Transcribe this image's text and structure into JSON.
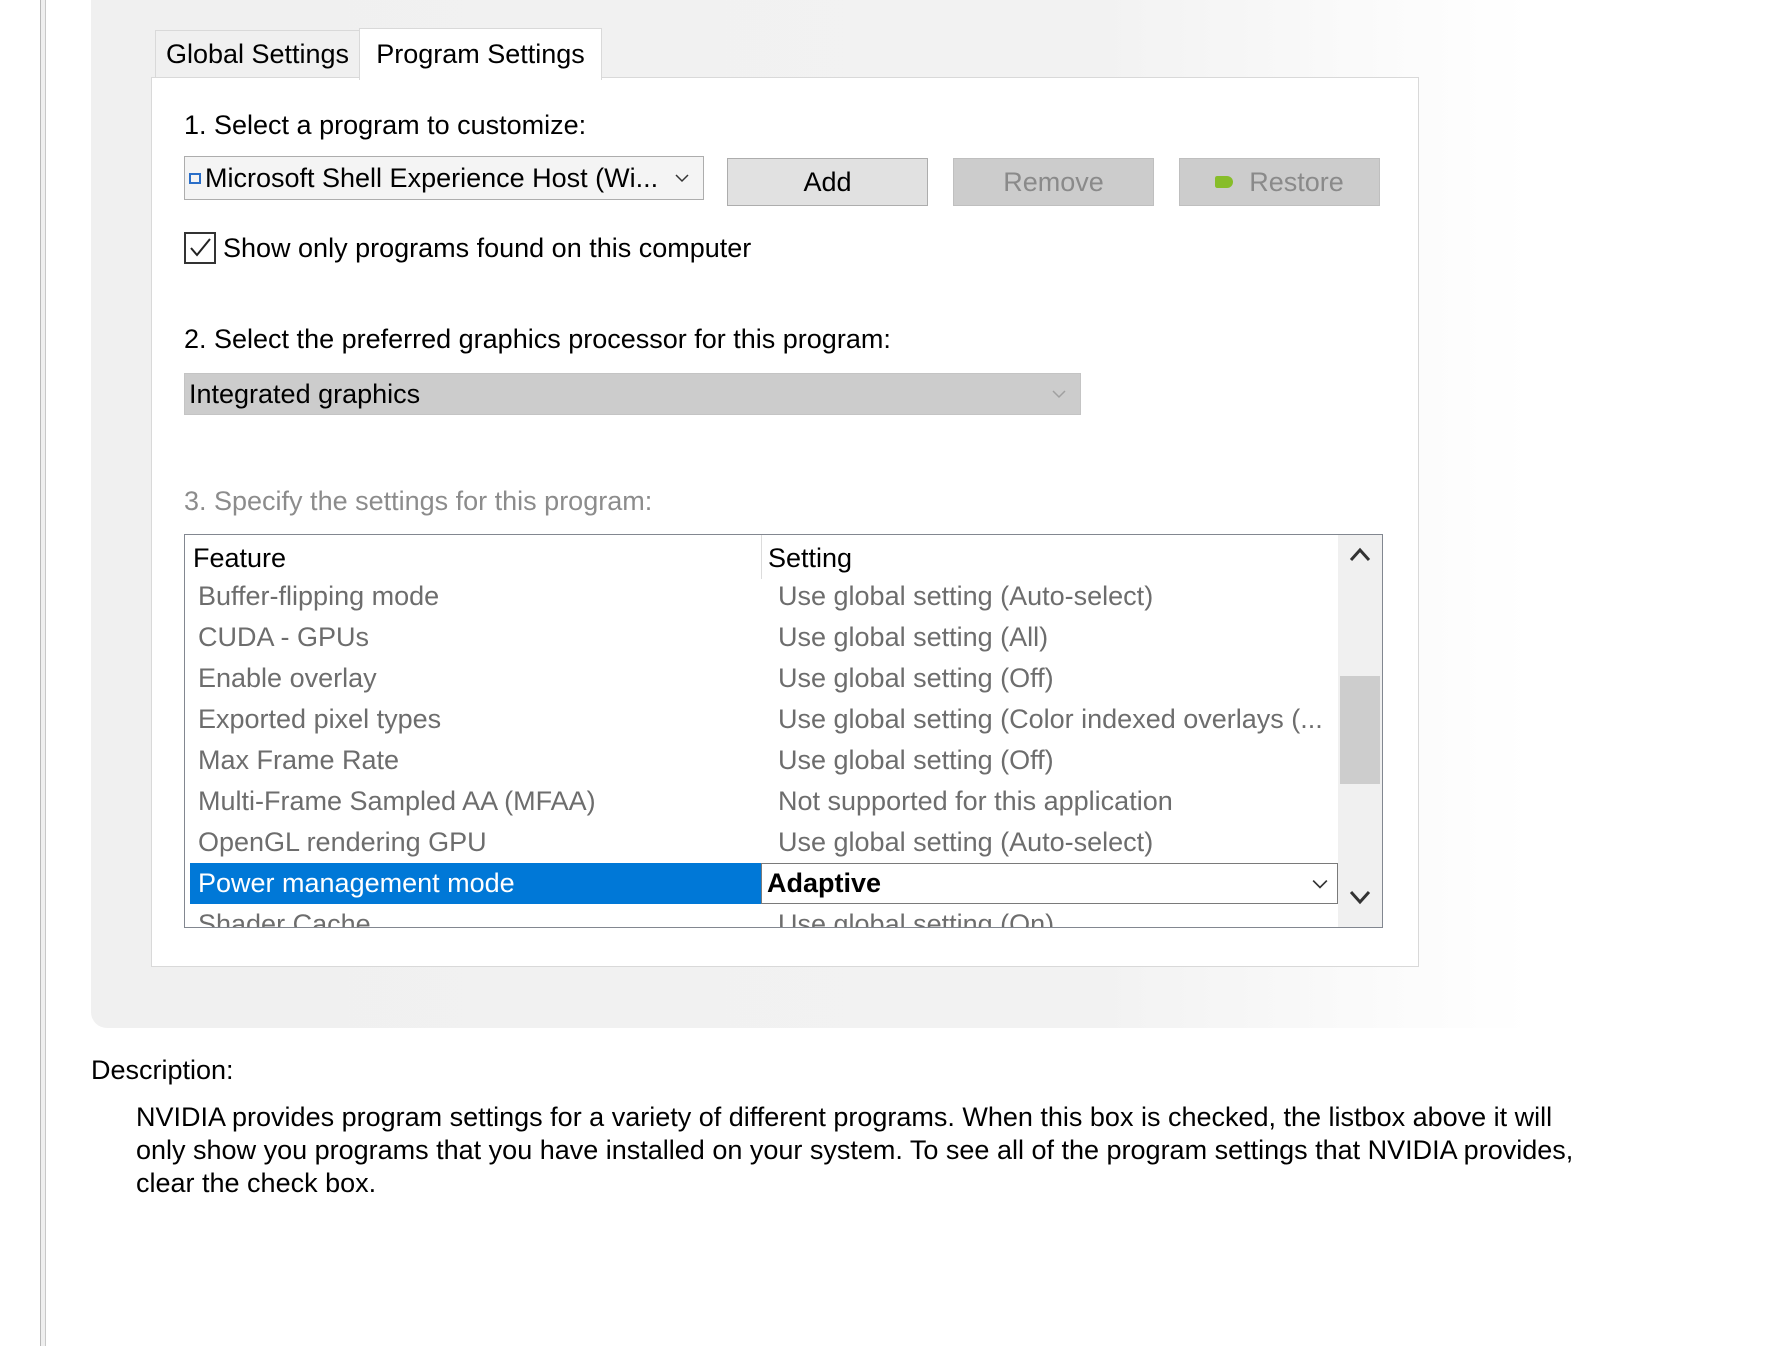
{
  "tabs": {
    "global": "Global Settings",
    "program": "Program Settings"
  },
  "step1": {
    "label": "1. Select a program to customize:",
    "selected_program": "Microsoft Shell Experience Host (Wi...",
    "add_label": "Add",
    "remove_label": "Remove",
    "restore_label": "Restore",
    "show_only_label": "Show only programs found on this computer",
    "show_only_checked": true
  },
  "step2": {
    "label": "2. Select the preferred graphics processor for this program:",
    "selected_gpu": "Integrated graphics"
  },
  "step3": {
    "label": "3. Specify the settings for this program:"
  },
  "grid": {
    "feature_header": "Feature",
    "setting_header": "Setting",
    "rows": [
      {
        "feature": "Buffer-flipping mode",
        "setting": "Use global setting (Auto-select)"
      },
      {
        "feature": "CUDA - GPUs",
        "setting": "Use global setting (All)"
      },
      {
        "feature": "Enable overlay",
        "setting": "Use global setting (Off)"
      },
      {
        "feature": "Exported pixel types",
        "setting": "Use global setting (Color indexed overlays (..."
      },
      {
        "feature": "Max Frame Rate",
        "setting": "Use global setting (Off)"
      },
      {
        "feature": "Multi-Frame Sampled AA (MFAA)",
        "setting": "Not supported for this application"
      },
      {
        "feature": "OpenGL rendering GPU",
        "setting": "Use global setting (Auto-select)"
      },
      {
        "feature": "Power management mode",
        "setting": "Adaptive"
      },
      {
        "feature": "Shader Cache",
        "setting": "Use global setting (On)"
      }
    ],
    "selected_index": 7
  },
  "description": {
    "title": "Description:",
    "body": "NVIDIA provides program settings for a variety of different programs. When this box is checked, the listbox above it will only show you programs that you have installed on your system. To see all of the program settings that NVIDIA provides, clear the check box."
  },
  "colors": {
    "selection": "#0078d7",
    "disabled_text": "#8c8c8c"
  }
}
